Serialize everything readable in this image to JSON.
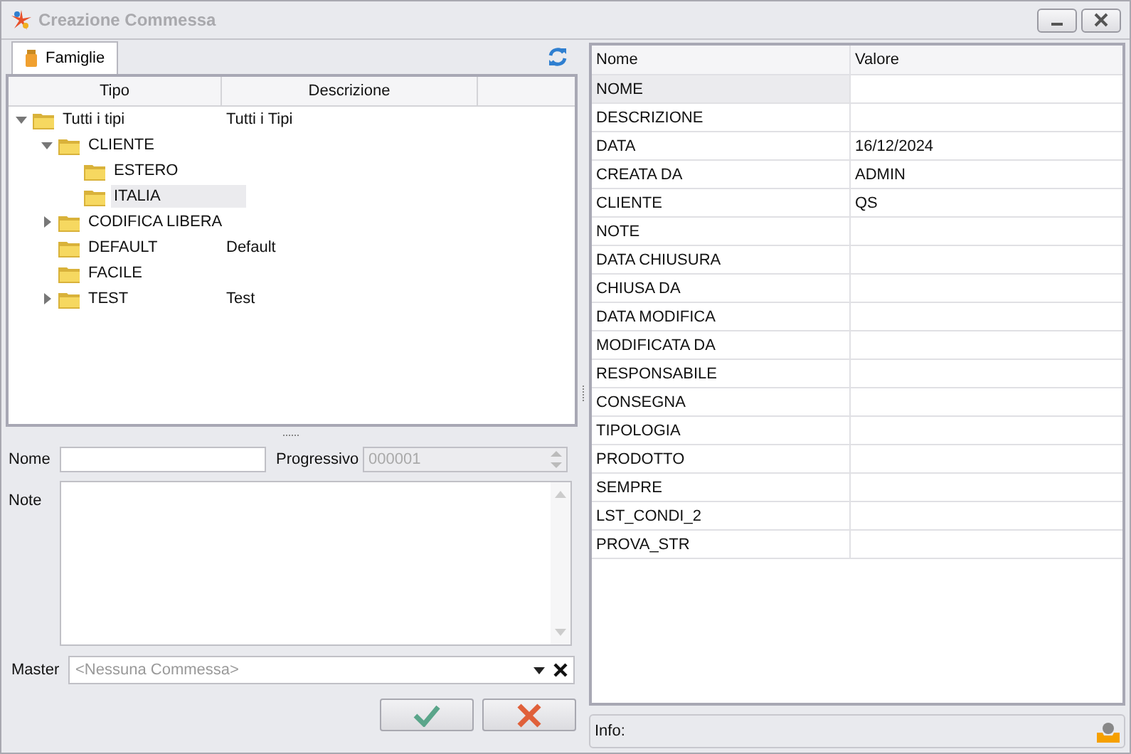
{
  "window": {
    "title": "Creazione Commessa"
  },
  "tabs": [
    {
      "label": "Famiglie",
      "selected": true
    }
  ],
  "tree": {
    "columns": [
      "Tipo",
      "Descrizione"
    ],
    "nodes": [
      {
        "tipo": "Tutti i tipi",
        "descrizione": "Tutti i Tipi",
        "expanded": true,
        "selected": false,
        "children": [
          {
            "tipo": "CLIENTE",
            "expanded": true,
            "selected": false,
            "children": [
              {
                "tipo": "ESTERO",
                "selected": false
              },
              {
                "tipo": "ITALIA",
                "selected": true
              }
            ]
          },
          {
            "tipo": "CODIFICA LIBERA",
            "expanded": false,
            "selected": false
          },
          {
            "tipo": "DEFAULT",
            "descrizione": "Default",
            "selected": false
          },
          {
            "tipo": "FACILE",
            "selected": false
          },
          {
            "tipo": "TEST",
            "descrizione": "Test",
            "expanded": false,
            "selected": false
          }
        ]
      }
    ]
  },
  "form": {
    "nome_label": "Nome",
    "progressivo_label": "Progressivo",
    "progressivo_value": "000001",
    "note_label": "Note",
    "master_label": "Master",
    "master_placeholder": "<Nessuna Commessa>"
  },
  "properties": {
    "columns": [
      "Nome",
      "Valore"
    ],
    "rows": [
      {
        "name": "NOME",
        "selected": true
      },
      {
        "name": "DESCRIZIONE",
        "selected": false
      },
      {
        "name": "DATA",
        "value": "16/12/2024",
        "selected": false
      },
      {
        "name": "CREATA DA",
        "value": "ADMIN",
        "selected": false
      },
      {
        "name": "CLIENTE",
        "value": "QS",
        "selected": false
      },
      {
        "name": "NOTE",
        "selected": false
      },
      {
        "name": "DATA CHIUSURA",
        "selected": false
      },
      {
        "name": "CHIUSA DA",
        "selected": false
      },
      {
        "name": "DATA MODIFICA",
        "selected": false
      },
      {
        "name": "MODIFICATA DA",
        "selected": false
      },
      {
        "name": "RESPONSABILE",
        "selected": false
      },
      {
        "name": "CONSEGNA",
        "selected": false
      },
      {
        "name": "TIPOLOGIA",
        "selected": false
      },
      {
        "name": "PRODOTTO",
        "selected": false
      },
      {
        "name": "SEMPRE",
        "selected": false
      },
      {
        "name": "LST_CONDI_2",
        "selected": false
      },
      {
        "name": "PROVA_STR",
        "selected": false
      }
    ]
  },
  "status_bar": {
    "label": "Info:"
  }
}
